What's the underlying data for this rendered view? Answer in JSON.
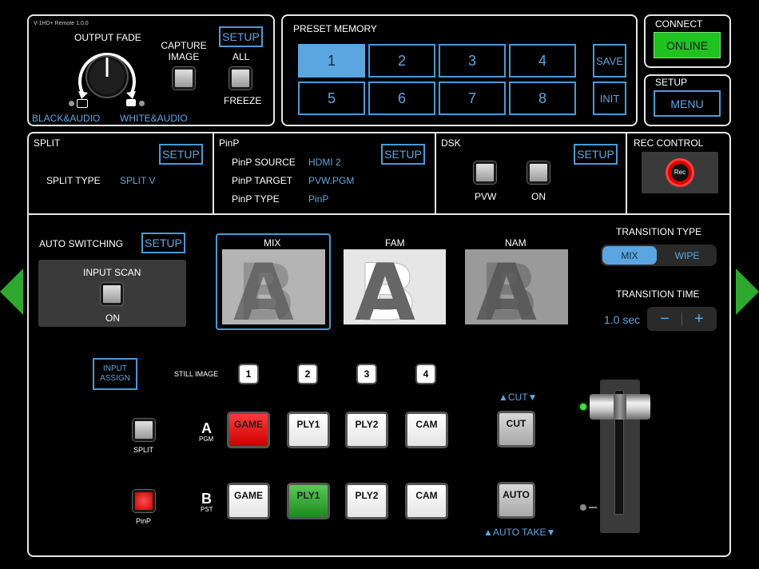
{
  "header": {
    "app_version": "V-1HD+ Remote 1.0.0",
    "output_fade": {
      "label": "OUTPUT FADE",
      "black_label": "BLACK&AUDIO",
      "white_label": "WHITE&AUDIO"
    },
    "capture_image_label": "CAPTURE\nIMAGE",
    "setup_label": "SETUP",
    "all_label": "ALL",
    "freeze_label": "FREEZE"
  },
  "preset_memory": {
    "title": "PRESET MEMORY",
    "buttons": [
      "1",
      "2",
      "3",
      "4",
      "5",
      "6",
      "7",
      "8"
    ],
    "selected": "1",
    "save_label": "SAVE",
    "init_label": "INIT"
  },
  "connect": {
    "title": "CONNECT",
    "status": "ONLINE"
  },
  "setup_box": {
    "title": "SETUP",
    "menu_label": "MENU"
  },
  "split": {
    "title": "SPLIT",
    "setup_label": "SETUP",
    "type_label": "SPLIT TYPE",
    "type_value": "SPLIT V"
  },
  "pinp": {
    "title": "PinP",
    "setup_label": "SETUP",
    "source_label": "PinP SOURCE",
    "source_value": "HDMI 2",
    "target_label": "PinP TARGET",
    "target_value": "PVW.PGM",
    "type_label": "PinP TYPE",
    "type_value": "PinP"
  },
  "dsk": {
    "title": "DSK",
    "setup_label": "SETUP",
    "pvw_label": "PVW",
    "on_label": "ON"
  },
  "rec_control": {
    "title": "REC CONTROL",
    "rec_label": "Rec"
  },
  "auto_switching": {
    "title": "AUTO SWITCHING",
    "setup_label": "SETUP",
    "input_scan_label": "INPUT SCAN",
    "on_label": "ON"
  },
  "transitions": {
    "mix_label": "MIX",
    "fam_label": "FAM",
    "nam_label": "NAM",
    "type_title": "TRANSITION TYPE",
    "type_options": [
      "MIX",
      "WIPE"
    ],
    "selected_type": "MIX",
    "time_title": "TRANSITION TIME",
    "time_value": "1.0 sec",
    "minus": "−",
    "plus": "+"
  },
  "switcher": {
    "input_assign_label": "INPUT\nASSIGN",
    "still_image_label": "STILL IMAGE",
    "still_buttons": [
      "1",
      "2",
      "3",
      "4"
    ],
    "split_label": "SPLIT",
    "pinp_label": "PinP",
    "a_label": "A",
    "pgm_label": "PGM",
    "b_label": "B",
    "pst_label": "PST",
    "a_row": [
      "GAME",
      "PLY1",
      "PLY2",
      "CAM"
    ],
    "b_row": [
      "GAME",
      "PLY1",
      "PLY2",
      "CAM"
    ],
    "a_active": "GAME",
    "b_active": "PLY1",
    "cut_top_label": "▲CUT▼",
    "cut_label": "CUT",
    "auto_label": "AUTO",
    "auto_take_label": "▲AUTO TAKE▼"
  },
  "colors": {
    "accent_blue": "#4a9ad6",
    "online_green": "#1fc21f",
    "pgm_red": "#e01010",
    "pst_green": "#2a9a2a",
    "nav_arrow": "#2ea82e"
  }
}
